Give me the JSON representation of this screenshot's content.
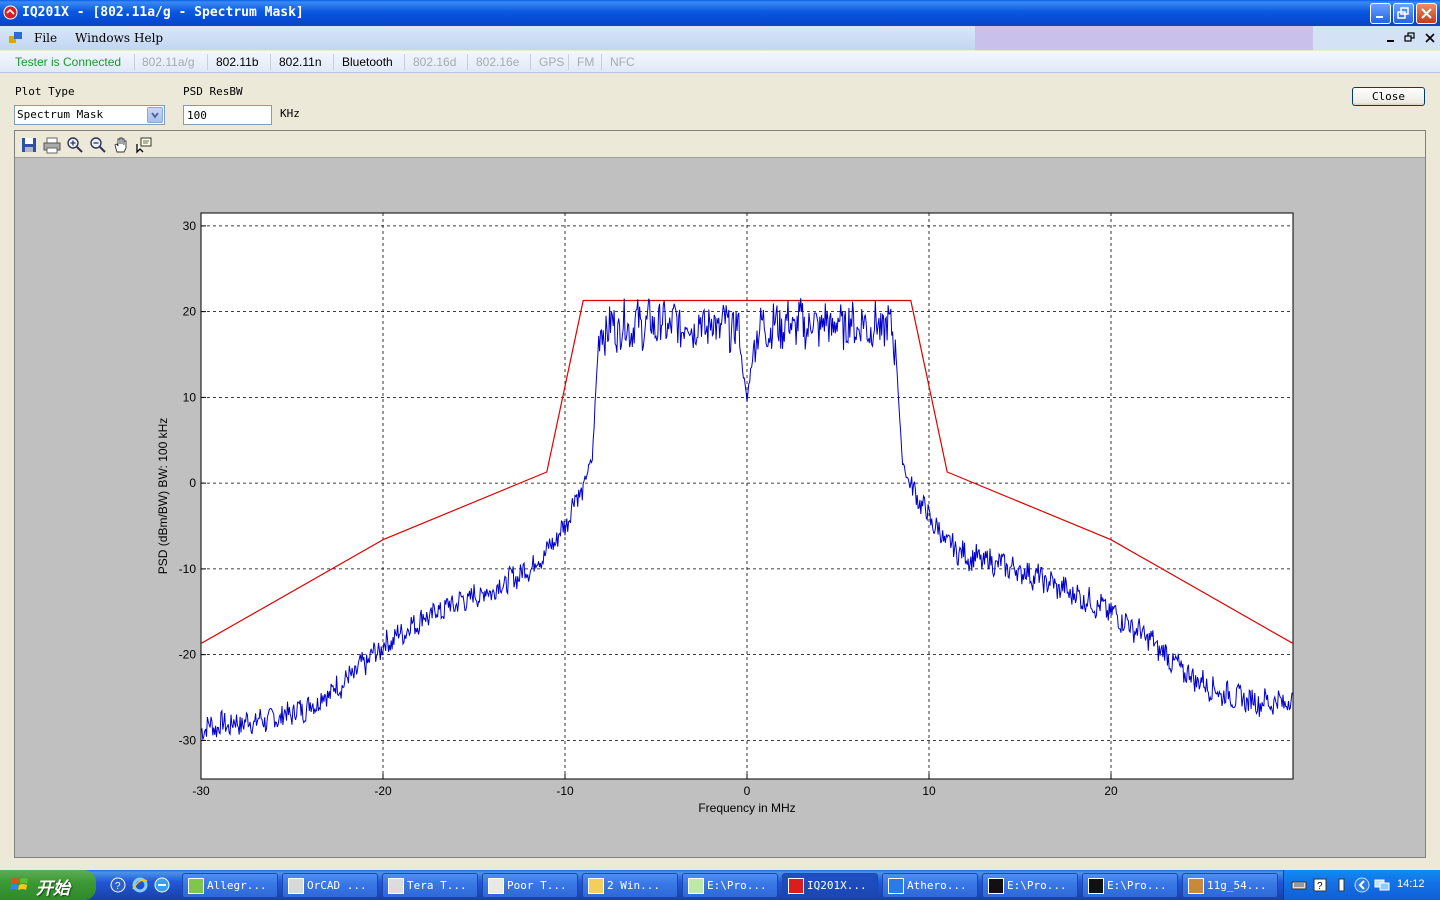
{
  "window": {
    "title": "IQ201X - [802.11a/g - Spectrum Mask]"
  },
  "menu": {
    "items": [
      "File",
      "Windows",
      "Help"
    ]
  },
  "tabs": {
    "status": "Tester is Connected",
    "items": [
      {
        "label": "802.11a/g",
        "enabled": false
      },
      {
        "label": "802.11b",
        "enabled": true
      },
      {
        "label": "802.11n",
        "enabled": true
      },
      {
        "label": "Bluetooth",
        "enabled": true
      },
      {
        "label": "802.16d",
        "enabled": false
      },
      {
        "label": "802.16e",
        "enabled": false
      },
      {
        "label": "GPS",
        "enabled": false
      },
      {
        "label": "FM",
        "enabled": false
      },
      {
        "label": "NFC",
        "enabled": false
      }
    ]
  },
  "controls": {
    "plot_type_label": "Plot Type",
    "plot_type_value": "Spectrum Mask",
    "psd_label": "PSD ResBW",
    "psd_value": "100",
    "psd_unit": "KHz",
    "close_label": "Close"
  },
  "plot_toolbar": [
    "save-icon",
    "print-icon",
    "zoom-in-icon",
    "zoom-out-icon",
    "pan-hand-icon",
    "data-cursor-icon"
  ],
  "chart_data": {
    "type": "line",
    "title": "",
    "xlabel": "Frequency in MHz",
    "ylabel": "PSD (dBm/BW) BW: 100 kHz",
    "xlim": [
      -30,
      30
    ],
    "ylim": [
      -34.5,
      31.5
    ],
    "xticks": [
      -30,
      -20,
      -10,
      0,
      10,
      20
    ],
    "yticks": [
      30,
      20,
      10,
      0,
      -10,
      -20,
      -30
    ],
    "grid": true,
    "colors": {
      "mask": "#e00000",
      "spectrum": "#0000cc",
      "background": "#ffffff",
      "grid": "#000000"
    },
    "series": [
      {
        "key": "mask",
        "x": [
          -30,
          -20,
          -11,
          -9,
          9,
          11,
          20,
          30
        ],
        "y": [
          -18.7,
          -6.6,
          1.3,
          21.3,
          21.3,
          1.3,
          -6.6,
          -18.7
        ]
      },
      {
        "key": "spectrum",
        "x": [
          -30,
          -28,
          -26,
          -24,
          -22,
          -20,
          -18,
          -16,
          -14,
          -12,
          -11,
          -10,
          -9.5,
          -9,
          -8.5,
          -8.2,
          -8,
          -6,
          -4,
          -2,
          -0.5,
          0,
          0.5,
          2,
          4,
          6,
          8,
          8.2,
          8.5,
          9,
          9.5,
          10,
          11,
          12,
          14,
          16,
          18,
          20,
          22,
          24,
          26,
          28,
          30
        ],
        "y": [
          -28.5,
          -28,
          -27.5,
          -26,
          -23,
          -19,
          -16,
          -14,
          -12.5,
          -10,
          -8,
          -5,
          -2,
          -0.5,
          3,
          15,
          18,
          18.5,
          18.5,
          18.5,
          18,
          9.5,
          18,
          18.5,
          18.5,
          18.5,
          18,
          15,
          3,
          -0.5,
          -2,
          -4,
          -7,
          -8.5,
          -9.5,
          -11,
          -13,
          -15,
          -18,
          -22,
          -24.5,
          -25.5,
          -25.5
        ]
      }
    ]
  },
  "taskbar": {
    "start_label": "开始",
    "quick_launch": [
      "help-icon",
      "ie-icon",
      "ie-alt-icon"
    ],
    "buttons": [
      {
        "label": "Allegr...",
        "icon": "allegro-icon",
        "active": false
      },
      {
        "label": "OrCAD ...",
        "icon": "orcad-icon",
        "active": false
      },
      {
        "label": "Tera T...",
        "icon": "teraterm-icon",
        "active": false
      },
      {
        "label": "Poor T...",
        "icon": "poortext-icon",
        "active": false
      },
      {
        "label": "2 Win...",
        "icon": "folder-icon",
        "active": false
      },
      {
        "label": "E:\\Pro...",
        "icon": "notepad-icon",
        "active": false
      },
      {
        "label": "IQ201X...",
        "icon": "iq-icon",
        "active": true
      },
      {
        "label": "Athero...",
        "icon": "atheros-icon",
        "active": false
      },
      {
        "label": "E:\\Pro...",
        "icon": "cmd-icon",
        "active": false
      },
      {
        "label": "E:\\Pro...",
        "icon": "cmd-icon",
        "active": false
      },
      {
        "label": "11g_54...",
        "icon": "app-icon",
        "active": false
      }
    ],
    "clock": "14:12"
  }
}
